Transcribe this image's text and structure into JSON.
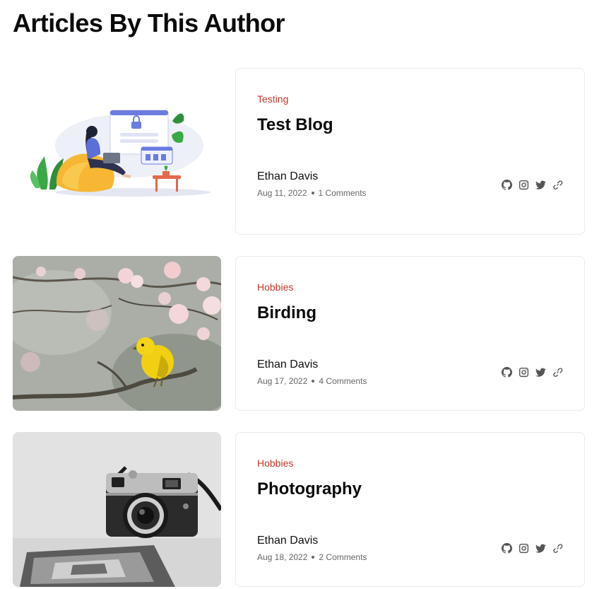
{
  "page": {
    "title": "Articles By This Author"
  },
  "articles": [
    {
      "image": "woman-laptop-login-illustration",
      "category": "Testing",
      "title": "Test Blog",
      "author": "Ethan Davis",
      "date": "Aug 11, 2022",
      "comments": "1 Comments",
      "socials": [
        "github-icon",
        "instagram-icon",
        "twitter-icon",
        "link-icon"
      ]
    },
    {
      "image": "yellow-bird-cherry-blossom-photo",
      "category": "Hobbies",
      "title": "Birding",
      "author": "Ethan Davis",
      "date": "Aug 17, 2022",
      "comments": "4 Comments",
      "socials": [
        "github-icon",
        "instagram-icon",
        "twitter-icon",
        "link-icon"
      ]
    },
    {
      "image": "vintage-camera-photo",
      "category": "Hobbies",
      "title": "Photography",
      "author": "Ethan Davis",
      "date": "Aug 18, 2022",
      "comments": "2 Comments",
      "socials": [
        "github-icon",
        "instagram-icon",
        "twitter-icon",
        "link-icon"
      ]
    }
  ],
  "colors": {
    "category": "#c0392b",
    "icon": "#555555",
    "card_border": "#e9e9ec"
  }
}
